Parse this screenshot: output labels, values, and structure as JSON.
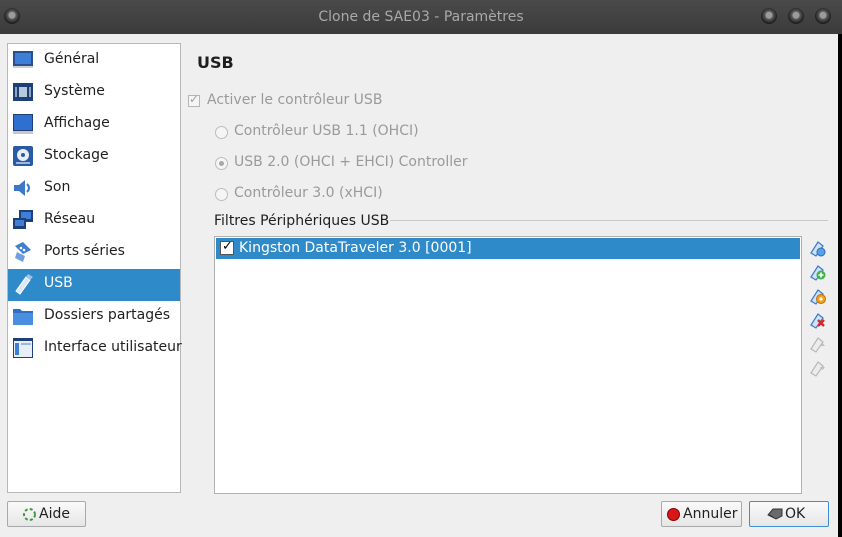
{
  "window": {
    "title": "Clone de SAE03 - Paramètres"
  },
  "sidebar": {
    "items": [
      {
        "label": "Général",
        "icon": "general-icon"
      },
      {
        "label": "Système",
        "icon": "system-icon"
      },
      {
        "label": "Affichage",
        "icon": "display-icon"
      },
      {
        "label": "Stockage",
        "icon": "storage-icon"
      },
      {
        "label": "Son",
        "icon": "audio-icon"
      },
      {
        "label": "Réseau",
        "icon": "network-icon"
      },
      {
        "label": "Ports séries",
        "icon": "serial-ports-icon"
      },
      {
        "label": "USB",
        "icon": "usb-icon",
        "selected": true
      },
      {
        "label": "Dossiers partagés",
        "icon": "shared-folders-icon"
      },
      {
        "label": "Interface utilisateur",
        "icon": "user-interface-icon"
      }
    ]
  },
  "usb": {
    "heading": "USB",
    "enable": {
      "label": "Activer le contrôleur USB",
      "checked": true
    },
    "controllers": [
      {
        "label": "Contrôleur USB 1.1 (OHCI)",
        "selected": false
      },
      {
        "label": "USB 2.0 (OHCI + EHCI) Controller",
        "selected": true
      },
      {
        "label": "Contrôleur 3.0 (xHCI)",
        "selected": false
      }
    ],
    "filters_label": "Filtres Périphériques USB",
    "filters": [
      {
        "label": "Kingston DataTraveler 3.0 [0001]",
        "checked": true
      }
    ],
    "tools": [
      "add-empty-filter-icon",
      "add-device-filter-icon",
      "edit-filter-icon",
      "remove-filter-icon",
      "move-up-icon",
      "move-down-icon"
    ]
  },
  "buttons": {
    "help": "Aide",
    "cancel": "Annuler",
    "ok": "OK"
  },
  "colors": {
    "selection": "#2f8ac9",
    "titlebar": "#3f3f3f",
    "background": "#efefef"
  }
}
